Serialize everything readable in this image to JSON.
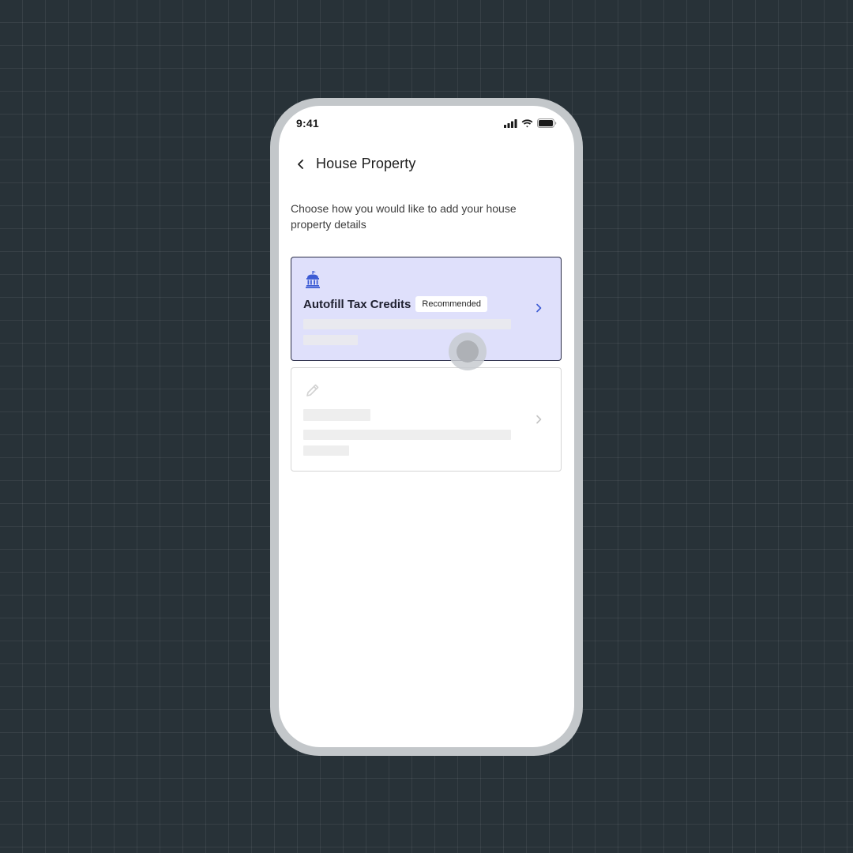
{
  "status_bar": {
    "time": "9:41",
    "icons": [
      "cellular-signal-icon",
      "wifi-icon",
      "battery-icon"
    ]
  },
  "header": {
    "back_icon": "chevron-left-icon",
    "title": "House Property"
  },
  "main": {
    "instruction": "Choose how you would like to add your house property details",
    "options": [
      {
        "icon": "government-building-icon",
        "title": "Autofill Tax Credits",
        "badge": "Recommended",
        "chevron": "chevron-right-icon",
        "selected": true
      },
      {
        "icon": "pencil-icon",
        "title": "",
        "chevron": "chevron-right-icon",
        "selected": false,
        "loading": true
      }
    ]
  },
  "colors": {
    "background": "#283238",
    "phone_frame": "#c3c7ca",
    "selected_card_bg": "#dfe0fb",
    "accent": "#3c5bd4",
    "skeleton": "#eeeeee"
  }
}
